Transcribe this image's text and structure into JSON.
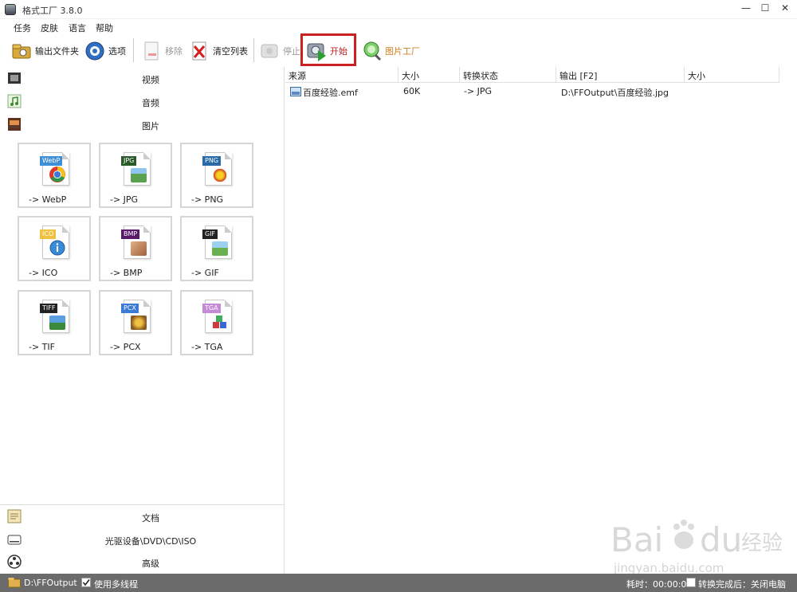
{
  "window": {
    "title": "格式工厂 3.8.0",
    "minimize": "—",
    "maximize": "☐",
    "close": "✕"
  },
  "menu": [
    "任务",
    "皮肤",
    "语言",
    "帮助"
  ],
  "toolbar": {
    "output_folder": "输出文件夹",
    "options": "选项",
    "remove": "移除",
    "clear_list": "清空列表",
    "stop": "停止",
    "start": "开始",
    "picture_factory": "图片工厂"
  },
  "categories": {
    "video": "视频",
    "audio": "音频",
    "picture": "图片",
    "document": "文档",
    "optical": "光驱设备\\DVD\\CD\\ISO",
    "advanced": "高级"
  },
  "formats": [
    {
      "label": "-> WebP",
      "tag": "WebP",
      "tag_color": "#3d8fd6"
    },
    {
      "label": "-> JPG",
      "tag": "JPG",
      "tag_color": "#2a5a2a"
    },
    {
      "label": "-> PNG",
      "tag": "PNG",
      "tag_color": "#2b6aa8"
    },
    {
      "label": "-> ICO",
      "tag": "ICO",
      "tag_color": "#f0c040"
    },
    {
      "label": "-> BMP",
      "tag": "BMP",
      "tag_color": "#5a1a6a"
    },
    {
      "label": "-> GIF",
      "tag": "GIF",
      "tag_color": "#222222"
    },
    {
      "label": "-> TIF",
      "tag": "TIFF",
      "tag_color": "#222222"
    },
    {
      "label": "-> PCX",
      "tag": "PCX",
      "tag_color": "#3a7bd5"
    },
    {
      "label": "-> TGA",
      "tag": "TGA",
      "tag_color": "#c48ad8"
    }
  ],
  "table": {
    "headers": [
      "来源",
      "大小",
      "转换状态",
      "输出 [F2]",
      "大小"
    ],
    "rows": [
      {
        "source": "百度经验.emf",
        "size": "60K",
        "status": "-> JPG",
        "output": "D:\\FFOutput\\百度经验.jpg",
        "out_size": ""
      }
    ]
  },
  "status": {
    "output_path": "D:\\FFOutput",
    "multithread_label": "使用多线程",
    "multithread_checked": true,
    "elapsed": "耗时：00:00:01",
    "after_done": "转换完成后：关闭电脑"
  },
  "watermark": {
    "text": "Bai",
    "text2": "du",
    "text3": "经验",
    "url": "jingyan.baidu.com"
  },
  "colors": {
    "highlight": "#cc1f1f",
    "statusbar": "#6b6b6b"
  }
}
